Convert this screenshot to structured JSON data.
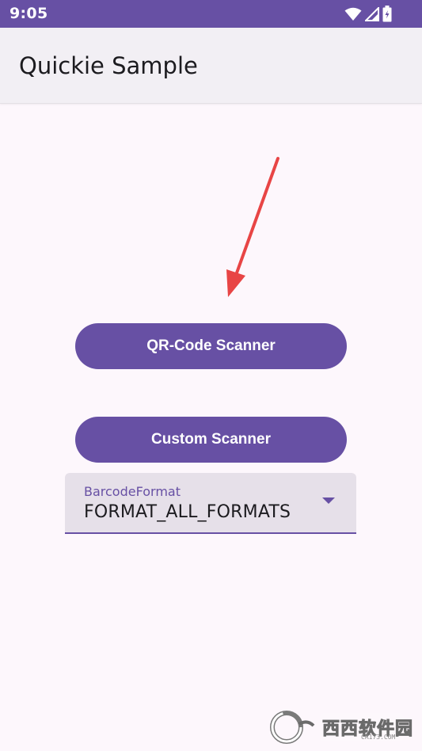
{
  "status_bar": {
    "time": "9:05",
    "icons": [
      "wifi-icon",
      "signal-icon",
      "battery-icon"
    ],
    "background_color": "#6750a4"
  },
  "app_bar": {
    "title": "Quickie Sample"
  },
  "buttons": {
    "qr_scanner_label": "QR-Code Scanner",
    "custom_scanner_label": "Custom Scanner",
    "color": "#6750a4"
  },
  "barcode_format_dropdown": {
    "label": "BarcodeFormat",
    "selected_value": "FORMAT_ALL_FORMATS",
    "icon": "dropdown-caret-icon"
  },
  "annotation": {
    "icon": "red-arrow-icon",
    "color": "#e84545"
  },
  "watermark": {
    "brand_text": "西西软件园",
    "url_text": "CR173.COM"
  }
}
